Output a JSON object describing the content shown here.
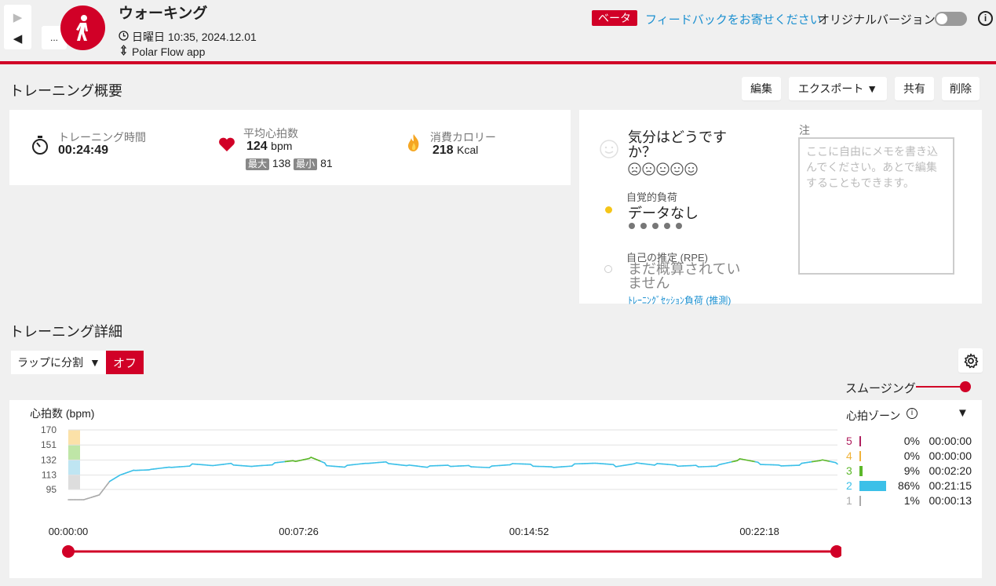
{
  "header": {
    "title": "ウォーキング",
    "datetime": "日曜日 10:35, 2024.12.01",
    "source": "Polar Flow app",
    "more": "...",
    "beta": "ベータ",
    "feedback": "フィードバックをお寄せください",
    "original_version": "オリジナルバージョン",
    "info": "i"
  },
  "summary": {
    "title": "トレーニング概要",
    "buttons": {
      "edit": "編集",
      "export": "エクスポート ▼",
      "share": "共有",
      "delete": "削除"
    },
    "duration": {
      "label": "トレーニング時間",
      "value": "00:24:49"
    },
    "heart_rate": {
      "label": "平均心拍数",
      "value": "124",
      "unit": "bpm",
      "max_label": "最大",
      "max": "138",
      "min_label": "最小",
      "min": "81"
    },
    "calories": {
      "label": "消費カロリー",
      "value": "218",
      "unit": "Kcal"
    }
  },
  "feeling": {
    "question": "気分はどうですか？",
    "perceived_label": "自覚的負荷",
    "perceived_value": "データなし",
    "rpe_label": "自己の推定 (RPE)",
    "rpe_value": "まだ概算されていません",
    "session_load": "ﾄﾚｰﾆﾝｸﾞｾｯｼｮﾝ負荷 (推測)",
    "note_label": "注",
    "note_placeholder": "ここに自由にメモを書き込んでください。あとで編集することもできます。"
  },
  "details": {
    "title": "トレーニング詳細",
    "lap_select": "ラップに分割",
    "off": "オフ",
    "smoothing": "スムージング"
  },
  "chart": {
    "ylabel": "心拍数 (bpm)",
    "zones_title": "心拍ゾーン",
    "y_ticks": [
      "170",
      "151",
      "132",
      "113",
      "95"
    ],
    "x_ticks": [
      "00:00:00",
      "00:07:26",
      "00:14:52",
      "00:22:18"
    ],
    "zones": [
      {
        "zone": "5",
        "percent": "0%",
        "time": "00:00:00",
        "color": "#b0205f",
        "fraction": 0.0
      },
      {
        "zone": "4",
        "percent": "0%",
        "time": "00:00:00",
        "color": "#f0b33a",
        "fraction": 0.0
      },
      {
        "zone": "3",
        "percent": "9%",
        "time": "00:02:20",
        "color": "#5cb82a",
        "fraction": 0.09
      },
      {
        "zone": "2",
        "percent": "86%",
        "time": "00:21:15",
        "color": "#3cc0e8",
        "fraction": 0.86
      },
      {
        "zone": "1",
        "percent": "1%",
        "time": "00:00:13",
        "color": "#aaaaaa",
        "fraction": 0.01
      }
    ]
  },
  "chart_data": {
    "type": "line",
    "ylabel": "心拍数 (bpm)",
    "ylim": [
      81,
      170
    ],
    "y_ticks": [
      170,
      151,
      132,
      113,
      95
    ],
    "x_tick_labels": [
      "00:00:00",
      "00:07:26",
      "00:14:52",
      "00:22:18"
    ],
    "xlim_seconds": [
      0,
      1489
    ],
    "series": [
      {
        "x": [
          0,
          30,
          60,
          80,
          100,
          130,
          160,
          200,
          240,
          280,
          320,
          360,
          400,
          440,
          470,
          500,
          540,
          580,
          620,
          660,
          700,
          740,
          780,
          820,
          860,
          900,
          940,
          980,
          1020,
          1060,
          1100,
          1140,
          1180,
          1220,
          1260,
          1300,
          1340,
          1380,
          1420,
          1460,
          1489
        ],
        "y": [
          82,
          82,
          88,
          105,
          113,
          120,
          121,
          124,
          126,
          124,
          127,
          125,
          127,
          130,
          134,
          126,
          124,
          127,
          129,
          126,
          123,
          124,
          125,
          124,
          126,
          125,
          124,
          126,
          127,
          125,
          129,
          126,
          124,
          125,
          126,
          132,
          127,
          126,
          127,
          131,
          127
        ]
      }
    ],
    "zone_colors": {
      "zone1": "#aaaaaa",
      "zone2": "#3cc0e8",
      "zone3": "#5cb82a",
      "zone4": "#f0b33a",
      "zone5": "#b0205f"
    }
  }
}
